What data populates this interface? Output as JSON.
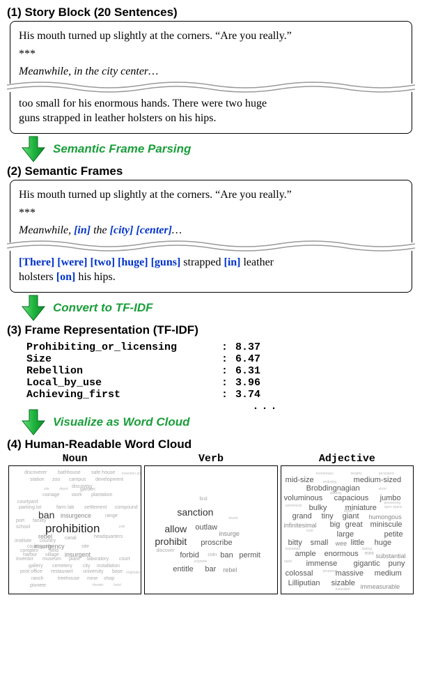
{
  "sections": {
    "s1": "(1) Story Block (20 Sentences)",
    "s2": "(2) Semantic Frames",
    "s3": "(3) Frame Representation (TF-IDF)",
    "s4": "(4) Human-Readable Word Cloud"
  },
  "arrows": {
    "a1": "Semantic Frame Parsing",
    "a2": "Convert to TF-IDF",
    "a3": "Visualize as Word Cloud"
  },
  "story1": {
    "line1": "His mouth turned up slightly at the corners. “Are you really.”",
    "asterisks": "***",
    "line2_pre": "Meanwhile, in the city center",
    "line2_trail": "…",
    "line3a": "too small for his enormous hands. There were two huge",
    "line3b": "guns strapped in leather holsters on his hips."
  },
  "story2": {
    "line1": "His mouth turned up slightly at the corners. “Are you really.”",
    "asterisks": "***",
    "meanwhile": "Meanwhile, ",
    "in1": "in",
    "the1": " the ",
    "city": "city",
    "sp1": " ",
    "center": "center",
    "trail": "…",
    "there": "There",
    "were": "were",
    "two": "two",
    "huge": "huge",
    "guns": "guns",
    "strapped": " strapped ",
    "in2": "in",
    "leather": " leather",
    "holsters_pre": "holsters ",
    "on": "on",
    "hips": " his hips."
  },
  "tfidf": [
    {
      "name": "Prohibiting_or_licensing",
      "value": "8.37"
    },
    {
      "name": "Size",
      "value": "6.47"
    },
    {
      "name": "Rebellion",
      "value": "6.31"
    },
    {
      "name": "Local_by_use",
      "value": "3.96"
    },
    {
      "name": "Achieving_first",
      "value": "3.74"
    }
  ],
  "tfidf_dots": "...",
  "wc_heads": {
    "noun": "Noun",
    "verb": "Verb",
    "adj": "Adjective"
  },
  "wc_noun": {
    "prohibition": "prohibition",
    "ban": "ban",
    "insurgence": "insurgence",
    "rebel": "rebel",
    "insurgent": "insurgent",
    "insurgency": "insurgency",
    "pioneer": "pioneer",
    "discoverer": "discoverer",
    "bathhouse": "bathhouse",
    "safehouse": "safe house",
    "station": "station",
    "zoo": "zoo",
    "campus": "campus",
    "invention": "invention artifact",
    "development": "development",
    "discovery": "discovery",
    "coinage": "coinage",
    "work": "work",
    "plantation": "plantation",
    "courtyard": "courtyard",
    "depot": "depot",
    "garden": "garden",
    "parkinglot": "parking lot",
    "farmlab": "farm lab",
    "settlement": "settlement",
    "compound": "compound",
    "port": "port",
    "facility": "facility",
    "canal": "canal",
    "range": "range",
    "institute": "institute",
    "country": "country",
    "countryside": "countryside",
    "site": "site",
    "complex": "complex",
    "field": "field",
    "harbor": "harbor",
    "village": "village",
    "museum": "museum",
    "plant": "plant",
    "laboratory": "laboratory",
    "court": "court",
    "gallery": "gallery",
    "cemetery": "cemetery",
    "city": "city",
    "installation": "installation",
    "postoffice": "post office",
    "restaurant": "restaurant",
    "university": "university",
    "base": "base",
    "originator": "originator",
    "ranch": "ranch",
    "treehouse": "treehouse",
    "headquarters": "headquarters",
    "mine": "mine",
    "shop": "shop",
    "theater": "theater",
    "inventor": "inventor",
    "pub": "pub",
    "school": "school",
    "hotel": "hotel"
  },
  "wc_verb": {
    "sanction": "sanction",
    "allow": "allow",
    "outlaw": "outlaw",
    "prohibit": "prohibit",
    "proscribe": "proscribe",
    "forbid": "forbid",
    "ban": "ban",
    "permit": "permit",
    "entitle": "entitle",
    "bar": "bar",
    "rebel": "rebel",
    "insurge": "insurge",
    "find": "find",
    "invent": "invent",
    "discover": "discover",
    "originate": "originate",
    "coin": "coin"
  },
  "wc_adj": {
    "midsize": "mid-size",
    "mediumsized": "medium-sized",
    "brob": "Brobdingnagian",
    "voluminous": "voluminous",
    "capacious": "capacious",
    "jumbo": "jumbo",
    "bulky": "bulky",
    "miniature": "miniature",
    "grand": "grand",
    "tiny": "tiny",
    "giant": "giant",
    "humongous": "humongous",
    "infinitesimal": "infinitesimal",
    "big": "big",
    "great": "great",
    "miniscule": "miniscule",
    "large": "large",
    "petite": "petite",
    "bitty": "bitty",
    "small": "small",
    "wee": "wee",
    "little": "little",
    "huge": "huge",
    "ample": "ample",
    "enormous": "enormous",
    "mini": "mini",
    "substantial": "substantial",
    "immense": "immense",
    "gigantic": "gigantic",
    "puny": "puny",
    "colossal": "colossal",
    "massive": "massive",
    "medium": "medium",
    "lilliputian": "Lilliputian",
    "sizable": "sizable",
    "immeasurable": "immeasurable",
    "rural": "rural",
    "urban": "urban",
    "ephemeral": "ephemeral",
    "enduring": "enduring",
    "persistent": "persistent",
    "pioneering": "pioneering",
    "momentary": "momentary",
    "lengthy": "lengthy",
    "short": "short",
    "abiding": "abiding",
    "rapid": "rapid",
    "perpetual": "perpetual",
    "lasting": "lasting",
    "sustained": "sustained",
    "extended": "extended",
    "openspace": "open space"
  }
}
